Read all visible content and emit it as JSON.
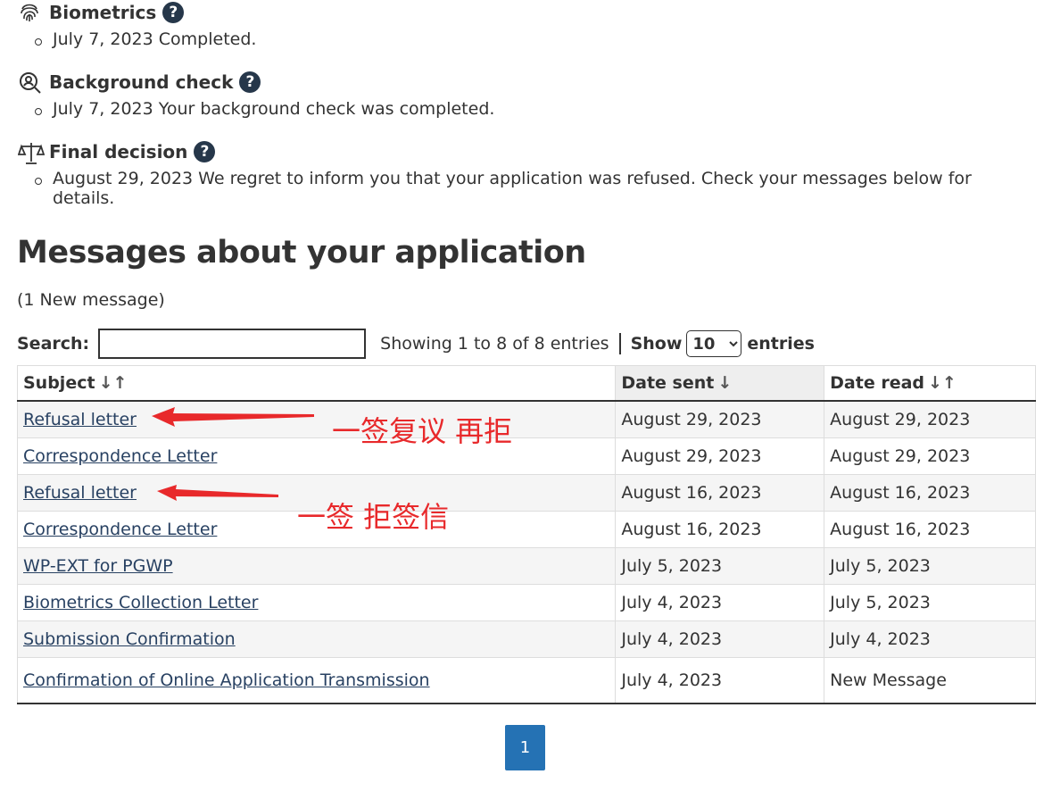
{
  "statuses": [
    {
      "icon": "fingerprint-icon",
      "title": "Biometrics",
      "item": "July 7, 2023 Completed."
    },
    {
      "icon": "magnifier-person-icon",
      "title": "Background check",
      "item": "July 7, 2023 Your background check was completed."
    },
    {
      "icon": "scales-icon",
      "title": "Final decision",
      "item": "August 29, 2023 We regret to inform you that your application was refused. Check your messages below for details."
    }
  ],
  "help_glyph": "?",
  "messages": {
    "heading": "Messages about your application",
    "new_count": "(1 New message)",
    "search_label": "Search:",
    "search_value": "",
    "info": "Showing 1 to 8 of 8 entries",
    "show_label": "Show",
    "show_value": "10",
    "entries_label": "entries",
    "columns": [
      "Subject",
      "Date sent",
      "Date read"
    ],
    "rows": [
      {
        "subject": "Refusal letter",
        "sent": "August 29, 2023",
        "read": "August 29, 2023"
      },
      {
        "subject": "Correspondence Letter",
        "sent": "August 29, 2023",
        "read": "August 29, 2023"
      },
      {
        "subject": "Refusal letter",
        "sent": "August 16, 2023",
        "read": "August 16, 2023"
      },
      {
        "subject": "Correspondence Letter",
        "sent": "August 16, 2023",
        "read": "August 16, 2023"
      },
      {
        "subject": "WP-EXT for PGWP",
        "sent": "July 5, 2023",
        "read": "July 5, 2023"
      },
      {
        "subject": "Biometrics Collection Letter",
        "sent": "July 4, 2023",
        "read": "July 5, 2023"
      },
      {
        "subject": "Submission Confirmation",
        "sent": "July 4, 2023",
        "read": "July 4, 2023"
      },
      {
        "subject": "Confirmation of Online Application Transmission",
        "sent": "July 4, 2023",
        "read": "New Message"
      }
    ],
    "page": "1"
  },
  "annotations": {
    "first": "一签复议 再拒",
    "second": "一签 拒签信",
    "color": "#e8292b"
  },
  "colors": {
    "link": "#284162",
    "help": "#26374a",
    "pager": "#2572b4"
  }
}
